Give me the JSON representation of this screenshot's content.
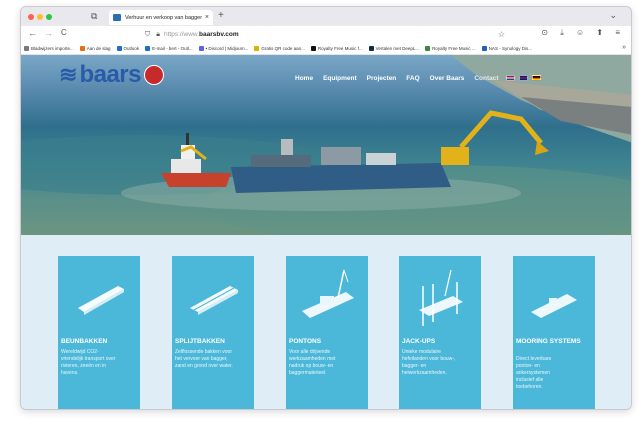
{
  "browser": {
    "tab_title": "Verhuur en verkoop van bagger",
    "tab_close": "×",
    "new_tab": "+",
    "tab_overview": "⧉",
    "tab_list": "⌄",
    "back": "←",
    "forward": "→",
    "reload": "C",
    "url_prefix": "https://www.",
    "url_domain": "baarsbv.com",
    "bookmark_star": "☆",
    "toolbar_icons": "⊙ ⤓ ☺ ⬆ ≡",
    "bookmarks_more": "»",
    "bookmarks": [
      {
        "label": "Bladwijzers importe...",
        "color": "#777777"
      },
      {
        "label": "Aan de slag",
        "color": "#e76b19"
      },
      {
        "label": "Outlook",
        "color": "#1a6fd1"
      },
      {
        "label": "E-mail - bert - Outl...",
        "color": "#1a6fd1"
      },
      {
        "label": "• Discord | Midjourn...",
        "color": "#5865f2"
      },
      {
        "label": "Gratis QR code aan...",
        "color": "#e0b000"
      },
      {
        "label": "Royalty Free Music f...",
        "color": "#111111"
      },
      {
        "label": "Vertalen met DeepL...",
        "color": "#0f2b46"
      },
      {
        "label": "Royalty Free Music ...",
        "color": "#3a8a3a"
      },
      {
        "label": "NAS - Synology Dis...",
        "color": "#1f5fbf"
      }
    ]
  },
  "site": {
    "logo_text": "baars",
    "nav": [
      "Home",
      "Equipment",
      "Projecten",
      "FAQ",
      "Over Baars",
      "Contact"
    ],
    "flag_colors": [
      [
        "#ae1c28",
        "#ffffff",
        "#21468b"
      ],
      [
        "#00247d",
        "#ffffff",
        "#cf142b"
      ],
      [
        "#000000",
        "#dd0000",
        "#ffce00"
      ]
    ]
  },
  "products": [
    {
      "title": "BEUNBAKKEN",
      "desc": "Wereldwijd CO2-vriendelijk transport over rivieren, zeeën en in havens."
    },
    {
      "title": "SPLIJTBAKKEN",
      "desc": "Zelflossende bakken voor het vervoer van bagger, zand en grond over water."
    },
    {
      "title": "PONTONS",
      "desc": "Voor alle drijvende werkzaamheden met nadruk op bouw- en baggermaterieel."
    },
    {
      "title": "JACK-UPS",
      "desc": "Unieke modulaire hefeilanden voor bouw-, bagger- en heiwerkzaamheden."
    },
    {
      "title": "MOORING SYSTEMS",
      "desc": "Direct leverbare ponton- en ankersystemen inclusief alle toebehoren."
    }
  ]
}
